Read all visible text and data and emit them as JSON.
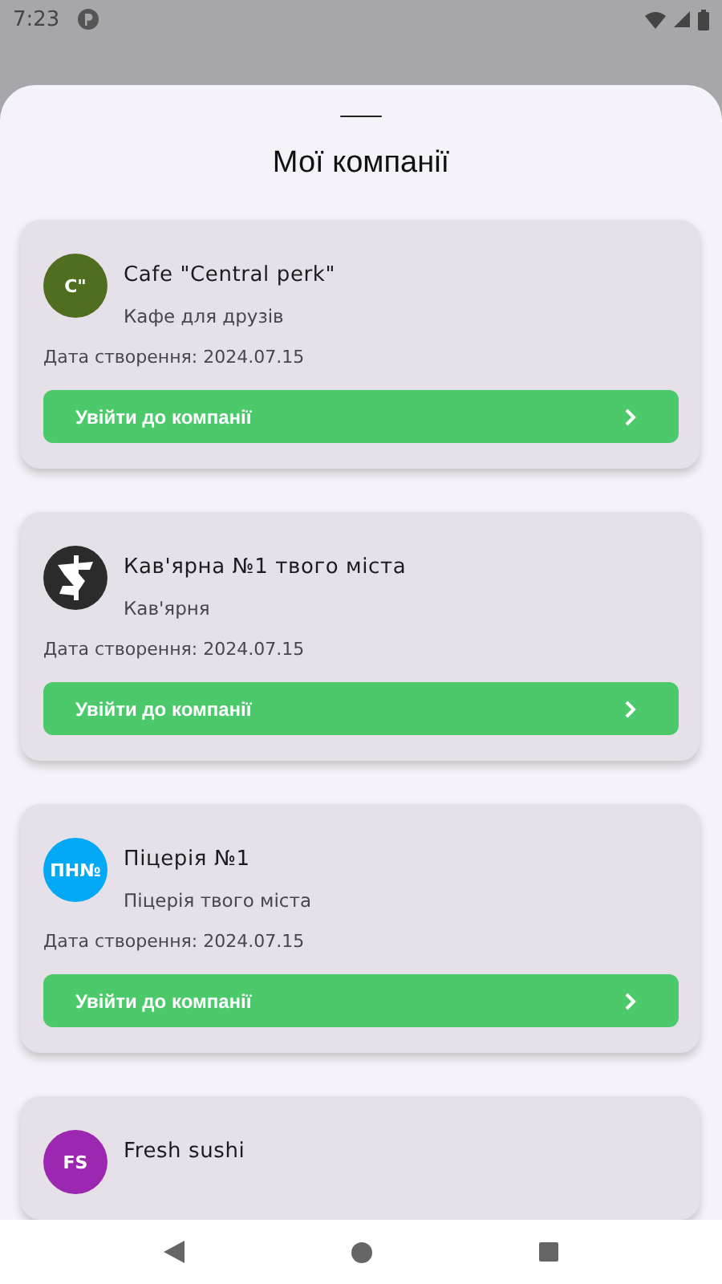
{
  "status_bar": {
    "time": "7:23"
  },
  "title": "Мої компанії",
  "companies": [
    {
      "kind": "initials",
      "initials": "C\"",
      "color": "#4f6e1f",
      "name": "Cafe \"Central perk\"",
      "subtitle": "Кафе для друзів",
      "date": "Дата створення: 2024.07.15",
      "button": "Увійти до компанії"
    },
    {
      "kind": "logo",
      "color": "#2b2b2b",
      "name": "Кав'ярна №1 твого міста",
      "subtitle": "Кав'ярня",
      "date": "Дата створення: 2024.07.15",
      "button": "Увійти до компанії"
    },
    {
      "kind": "initials",
      "initials": "ПН№",
      "color": "#03a9f4",
      "name": "Піцерія №1",
      "subtitle": "Піцерія твого міста",
      "date": "Дата створення: 2024.07.15",
      "button": "Увійти до компанії"
    },
    {
      "kind": "initials",
      "initials": "FS",
      "color": "#9c27b0",
      "name": "Fresh sushi"
    }
  ]
}
